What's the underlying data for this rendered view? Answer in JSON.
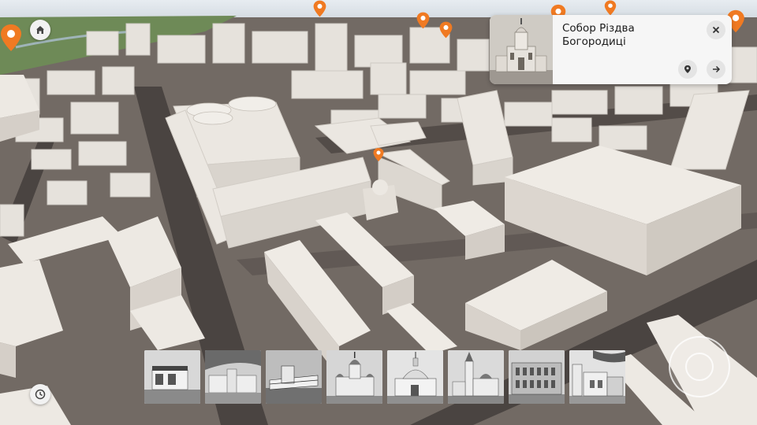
{
  "colors": {
    "accent": "#f07a22",
    "ground": "#726a64",
    "road": "#4a4441",
    "building": "#e9e5df",
    "panel": "#f6f6f6"
  },
  "toolbar": {
    "home_icon": "home-icon",
    "history_icon": "clock-icon"
  },
  "info_card": {
    "title": "Собор Різдва Богородиці",
    "close_icon": "close-icon",
    "locate_icon": "map-pin-icon",
    "open_icon": "arrow-right-icon"
  },
  "thumbnails": [
    {
      "name": "modernist-building"
    },
    {
      "name": "constructivist-buildings"
    },
    {
      "name": "modernist-complex"
    },
    {
      "name": "church-with-domes"
    },
    {
      "name": "cathedral-nativity"
    },
    {
      "name": "church-with-bell-tower"
    },
    {
      "name": "brick-building"
    },
    {
      "name": "street-buildings"
    }
  ],
  "navigation": {
    "compass_icon": "joystick-icon"
  }
}
